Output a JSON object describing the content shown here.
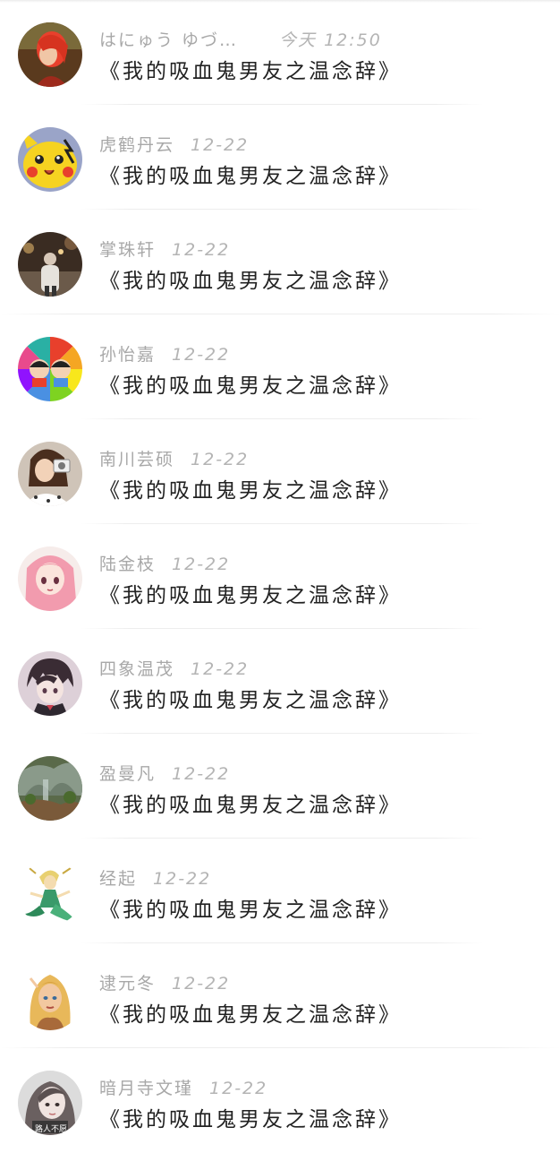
{
  "conversations": [
    {
      "name": "はにゅう ゆづ…",
      "time": "今天 12:50",
      "message": "《我的吸血鬼男友之温念辞》",
      "avatar_icon": "avatar-red-hair-icon"
    },
    {
      "name": "虎鹤丹云",
      "time": "12-22",
      "message": "《我的吸血鬼男友之温念辞》",
      "avatar_icon": "avatar-pikachu-icon"
    },
    {
      "name": "掌珠轩",
      "time": "12-22",
      "message": "《我的吸血鬼男友之温念辞》",
      "avatar_icon": "avatar-night-street-icon"
    },
    {
      "name": "孙怡嘉",
      "time": "12-22",
      "message": "《我的吸血鬼男友之温念辞》",
      "avatar_icon": "avatar-color-wheel-icon"
    },
    {
      "name": "南川芸硕",
      "time": "12-22",
      "message": "《我的吸血鬼男友之温念辞》",
      "avatar_icon": "avatar-girl-camera-icon"
    },
    {
      "name": "陆金枝",
      "time": "12-22",
      "message": "《我的吸血鬼男友之温念辞》",
      "avatar_icon": "avatar-pink-anime-girl-icon"
    },
    {
      "name": "四象温茂",
      "time": "12-22",
      "message": "《我的吸血鬼男友之温念辞》",
      "avatar_icon": "avatar-anime-boy-icon"
    },
    {
      "name": "盈曼凡",
      "time": "12-22",
      "message": "《我的吸血鬼男友之温念辞》",
      "avatar_icon": "avatar-rock-landscape-icon"
    },
    {
      "name": "经起",
      "time": "12-22",
      "message": "《我的吸血鬼男友之温念辞》",
      "avatar_icon": "avatar-green-fairy-icon"
    },
    {
      "name": "逮元冬",
      "time": "12-22",
      "message": "《我的吸血鬼男友之温念辞》",
      "avatar_icon": "avatar-blonde-elf-icon"
    },
    {
      "name": "暗月寺文瑾",
      "time": "12-22",
      "message": "《我的吸血鬼男友之温念辞》",
      "avatar_icon": "avatar-girl-portrait-icon",
      "avatar_caption": "路人不愿"
    }
  ]
}
